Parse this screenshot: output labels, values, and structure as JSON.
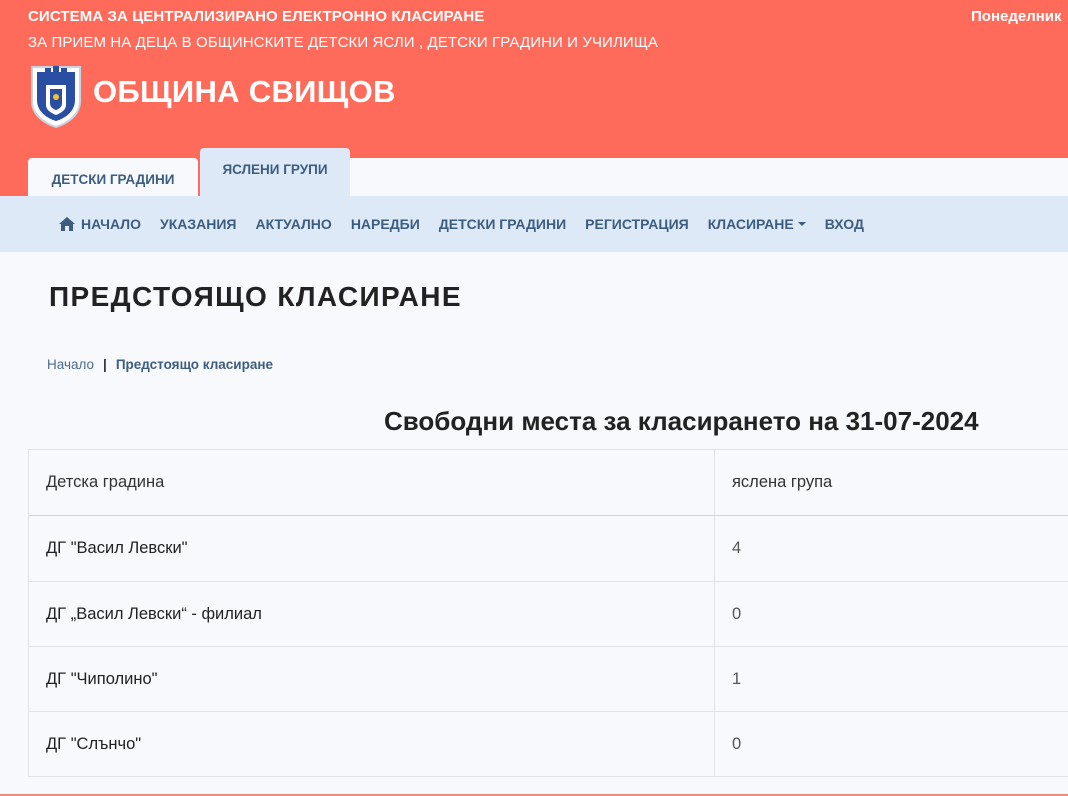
{
  "header": {
    "title": "СИСТЕМА ЗА ЦЕНТРАЛИЗИРАНО ЕЛЕКТРОННО КЛАСИРАНЕ",
    "subtitle": "ЗА ПРИЕМ НА ДЕЦА В ОБЩИНСКИТЕ ДЕТСКИ ЯСЛИ , ДЕТСКИ ГРАДИНИ И УЧИЛИЩА",
    "date": "Понеделник",
    "municipality": "ОБЩИНА СВИЩОВ",
    "logo_icon": "coat-of-arms-icon",
    "accent_color": "#ff6b5b"
  },
  "tabs": [
    {
      "label": "ДЕТСКИ ГРАДИНИ"
    },
    {
      "label": "ЯСЛЕНИ ГРУПИ",
      "active": true
    }
  ],
  "nav": {
    "items": [
      {
        "label": "НАЧАЛО",
        "icon": "home-icon"
      },
      {
        "label": "УКАЗАНИЯ"
      },
      {
        "label": "АКТУАЛНО"
      },
      {
        "label": "НАРЕДБИ"
      },
      {
        "label": "ДЕТСКИ ГРАДИНИ"
      },
      {
        "label": "РЕГИСТРАЦИЯ"
      },
      {
        "label": "КЛАСИРАНЕ",
        "dropdown": true
      },
      {
        "label": "ВХОД"
      }
    ],
    "color": "#3d5d80"
  },
  "page": {
    "title": "ПРЕДСТОЯЩО КЛАСИРАНЕ",
    "breadcrumb": {
      "home": "Начало",
      "separator": "|",
      "current": "Предстоящо класиране"
    },
    "section_title": "Свободни места за класирането на 31-07-2024"
  },
  "table": {
    "headers": [
      "Детска градина",
      "яслена група"
    ],
    "rows": [
      [
        "ДГ \"Васил Левски\"",
        "4"
      ],
      [
        "ДГ „Васил Левски“ - филиал",
        "0"
      ],
      [
        "ДГ \"Чиполино\"",
        "1"
      ],
      [
        "ДГ \"Слънчо\"",
        "0"
      ]
    ]
  }
}
